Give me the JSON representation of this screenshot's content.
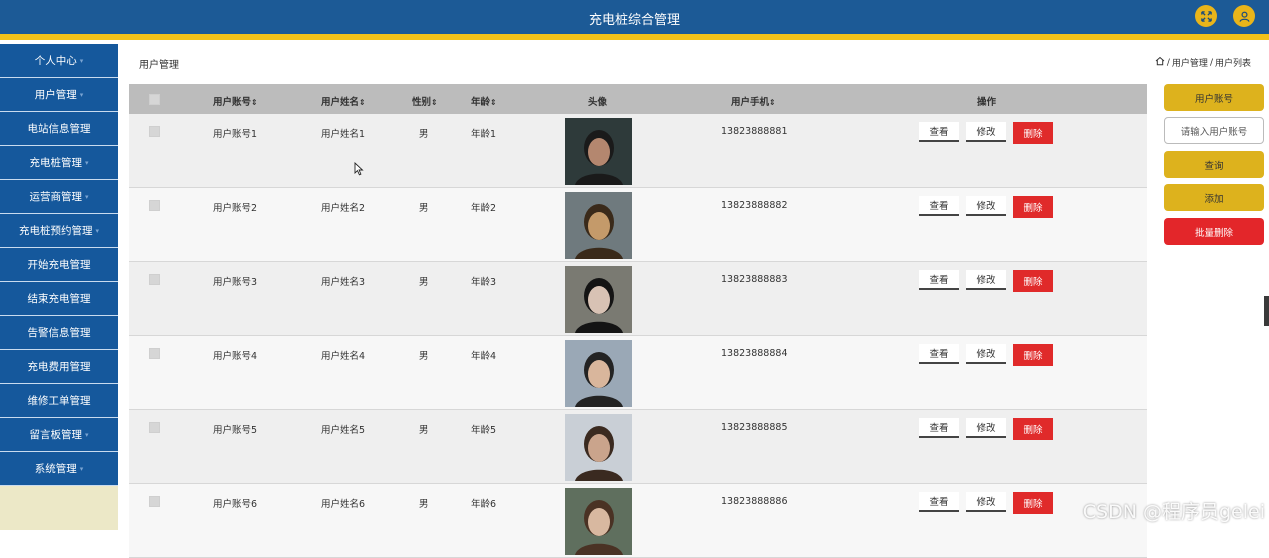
{
  "header": {
    "title": "充电桩综合管理",
    "accent_color": "#1c5a96",
    "stripe_color": "#f2c21a"
  },
  "header_icons": [
    "fullscreen-icon",
    "user-icon"
  ],
  "sidebar": {
    "items": [
      {
        "label": "个人中心",
        "caret": true
      },
      {
        "label": "用户管理",
        "caret": true
      },
      {
        "label": "电站信息管理",
        "caret": false
      },
      {
        "label": "充电桩管理",
        "caret": true
      },
      {
        "label": "运营商管理",
        "caret": true
      },
      {
        "label": "充电桩预约管理",
        "caret": true
      },
      {
        "label": "开始充电管理",
        "caret": false
      },
      {
        "label": "结束充电管理",
        "caret": false
      },
      {
        "label": "告警信息管理",
        "caret": false
      },
      {
        "label": "充电费用管理",
        "caret": false
      },
      {
        "label": "维修工单管理",
        "caret": false
      },
      {
        "label": "留言板管理",
        "caret": true
      },
      {
        "label": "系统管理",
        "caret": true
      }
    ]
  },
  "page": {
    "title": "用户管理",
    "breadcrumb": {
      "sep": "/",
      "level1": "用户管理",
      "level2": "用户列表"
    }
  },
  "table": {
    "headers": {
      "account": "用户账号",
      "name": "用户姓名",
      "gender": "性别",
      "age": "年龄",
      "avatar": "头像",
      "phone": "用户手机",
      "actions": "操作"
    },
    "sort_glyph": "⇕",
    "rows": [
      {
        "account": "用户账号1",
        "name": "用户姓名1",
        "gender": "男",
        "age": "年龄1",
        "phone": "13823888881"
      },
      {
        "account": "用户账号2",
        "name": "用户姓名2",
        "gender": "男",
        "age": "年龄2",
        "phone": "13823888882"
      },
      {
        "account": "用户账号3",
        "name": "用户姓名3",
        "gender": "男",
        "age": "年龄3",
        "phone": "13823888883"
      },
      {
        "account": "用户账号4",
        "name": "用户姓名4",
        "gender": "男",
        "age": "年龄4",
        "phone": "13823888884"
      },
      {
        "account": "用户账号5",
        "name": "用户姓名5",
        "gender": "男",
        "age": "年龄5",
        "phone": "13823888885"
      },
      {
        "account": "用户账号6",
        "name": "用户姓名6",
        "gender": "男",
        "age": "年龄6",
        "phone": "13823888886"
      }
    ],
    "actions": {
      "view": "查看",
      "edit": "修改",
      "delete": "删除"
    }
  },
  "search_panel": {
    "field_label": "用户账号",
    "placeholder": "请输入用户账号",
    "search": "查询",
    "add": "添加",
    "batch_delete": "批量删除"
  },
  "watermark": "CSDN @程序员gelei"
}
